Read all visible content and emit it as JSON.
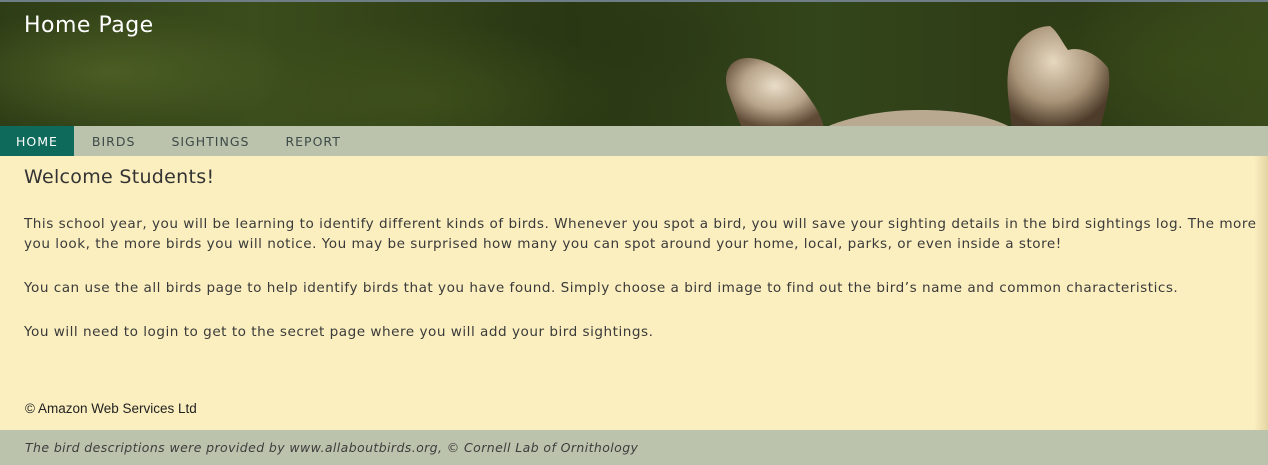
{
  "header": {
    "title": "Home Page"
  },
  "nav": {
    "items": [
      {
        "label": "HOME",
        "active": true
      },
      {
        "label": "BIRDS",
        "active": false
      },
      {
        "label": "SIGHTINGS",
        "active": false
      },
      {
        "label": "REPORT",
        "active": false
      }
    ]
  },
  "main": {
    "heading": "Welcome Students!",
    "paragraphs": [
      "This school year, you will be learning to identify different kinds of birds. Whenever you spot a bird, you will save your sighting details in the bird sightings log. The more you look, the more birds you will notice. You may be surprised how many you can spot around your home, local, parks, or even inside a store!",
      "You can use the all birds page to help identify birds that you have found. Simply choose a bird image to find out the bird’s name and common characteristics.",
      "You will need to login to get to the secret page where you will add your bird sightings."
    ]
  },
  "copyright": "© Amazon Web Services Ltd",
  "footer": {
    "text": "The bird descriptions were provided by www.allaboutbirds.org, © Cornell Lab of Ornithology"
  },
  "colors": {
    "nav_background": "#bcc3ac",
    "nav_active": "#0e6a5a",
    "page_background": "#fbefbf"
  }
}
